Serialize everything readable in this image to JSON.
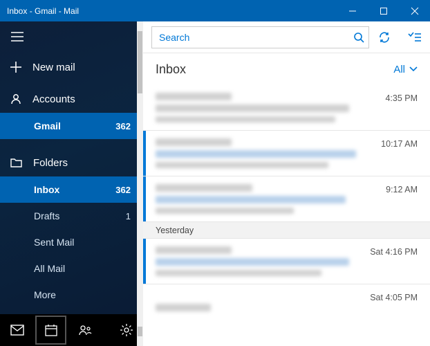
{
  "window": {
    "title": "Inbox - Gmail - Mail"
  },
  "sidebar": {
    "new_mail": "New mail",
    "accounts_label": "Accounts",
    "account": {
      "name": "Gmail",
      "count": "362"
    },
    "folders_label": "Folders",
    "folders": [
      {
        "name": "Inbox",
        "count": "362",
        "selected": true
      },
      {
        "name": "Drafts",
        "count": "1"
      },
      {
        "name": "Sent Mail"
      },
      {
        "name": "All Mail"
      },
      {
        "name": "More"
      }
    ]
  },
  "search": {
    "placeholder": "Search"
  },
  "header": {
    "folder": "Inbox",
    "filter": "All"
  },
  "messages": {
    "times": [
      "4:35 PM",
      "10:17 AM",
      "9:12 AM",
      "Sat 4:16 PM",
      "Sat 4:05 PM"
    ],
    "day_separator": "Yesterday"
  }
}
